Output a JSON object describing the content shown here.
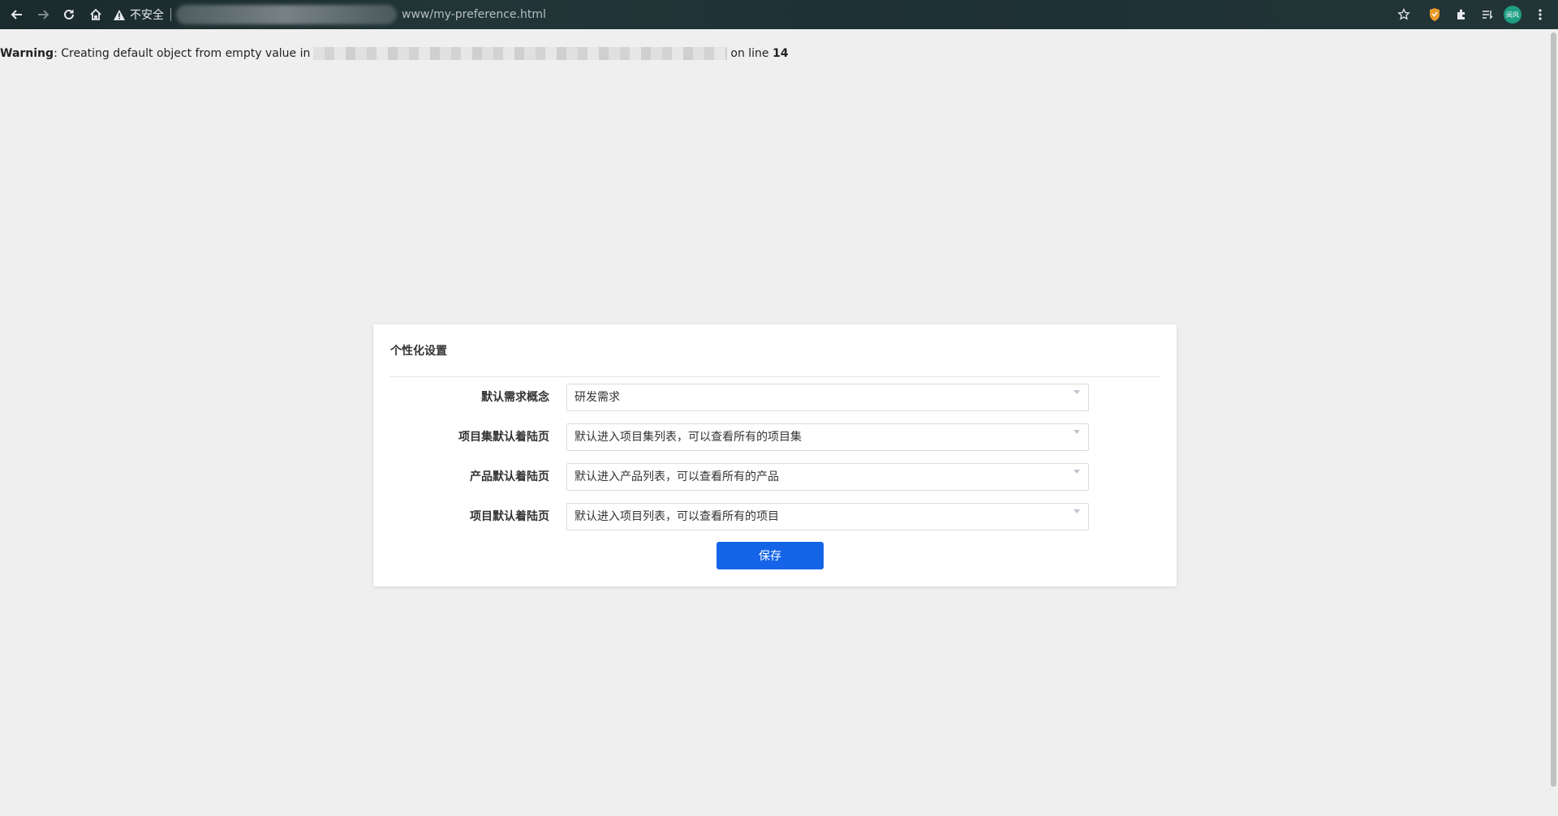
{
  "browser": {
    "security_label": "不安全",
    "url_path": "www/my-preference.html",
    "avatar_text": "阅风"
  },
  "warning": {
    "prefix": "Warning",
    "message": ": Creating default object from empty value in",
    "suffix": "on line",
    "line_number": "14"
  },
  "card": {
    "title": "个性化设置",
    "fields": [
      {
        "label": "默认需求概念",
        "value": "研发需求"
      },
      {
        "label": "项目集默认着陆页",
        "value": "默认进入项目集列表，可以查看所有的项目集"
      },
      {
        "label": "产品默认着陆页",
        "value": "默认进入产品列表，可以查看所有的产品"
      },
      {
        "label": "项目默认着陆页",
        "value": "默认进入项目列表，可以查看所有的项目"
      }
    ],
    "save_label": "保存"
  },
  "colors": {
    "accent": "#1564e8",
    "page_bg": "#efefef",
    "toolbar_bg": "#1d3034"
  }
}
